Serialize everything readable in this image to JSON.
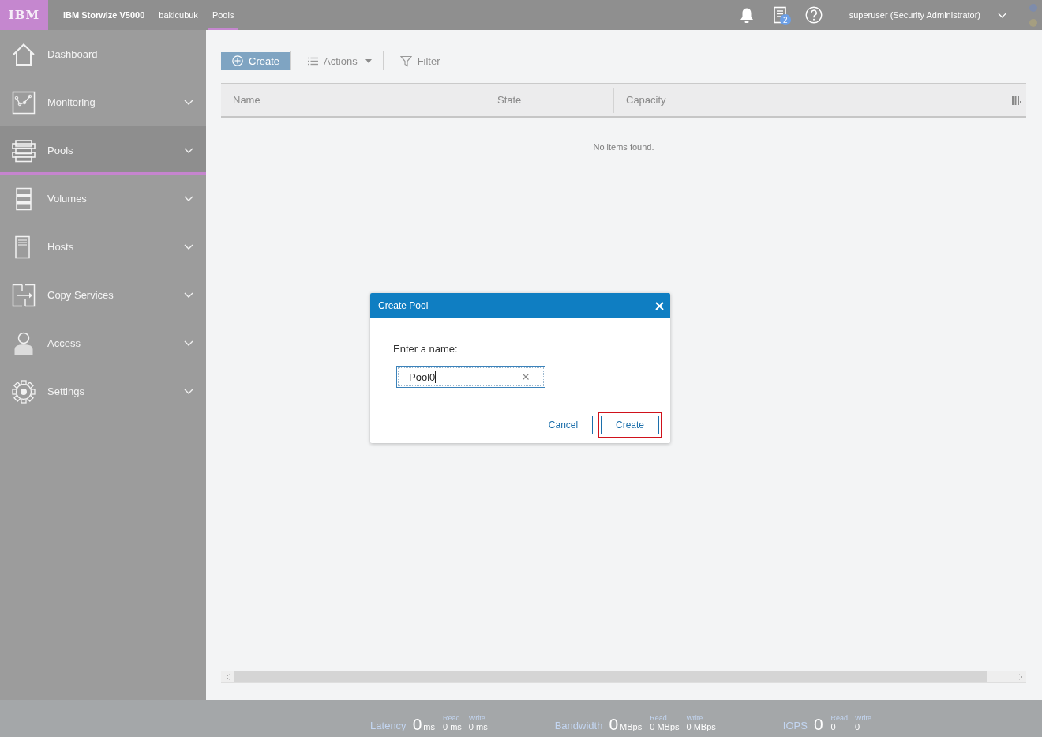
{
  "top_bar": {
    "logo": "IBM",
    "crumbs": [
      {
        "label": "IBM Storwize V5000",
        "selected": false
      },
      {
        "label": "bakicubuk",
        "selected": false
      },
      {
        "label": "Pools",
        "selected": true
      }
    ],
    "tasks_badge": "2",
    "user": "superuser (Security Administrator)"
  },
  "sidebar": {
    "items": [
      {
        "label": "Dashboard",
        "expandable": false,
        "selected": false
      },
      {
        "label": "Monitoring",
        "expandable": true,
        "selected": false
      },
      {
        "label": "Pools",
        "expandable": true,
        "selected": true
      },
      {
        "label": "Volumes",
        "expandable": true,
        "selected": false
      },
      {
        "label": "Hosts",
        "expandable": true,
        "selected": false
      },
      {
        "label": "Copy Services",
        "expandable": true,
        "selected": false
      },
      {
        "label": "Access",
        "expandable": true,
        "selected": false
      },
      {
        "label": "Settings",
        "expandable": true,
        "selected": false
      }
    ]
  },
  "toolbar": {
    "create": "Create",
    "actions": "Actions",
    "filter": "Filter"
  },
  "table": {
    "columns": [
      "Name",
      "State",
      "Capacity"
    ],
    "empty_message": "No items found."
  },
  "dialog": {
    "title": "Create Pool",
    "field_label": "Enter a name:",
    "name_field": {
      "value": "Pool0"
    },
    "buttons": [
      {
        "label": "Cancel",
        "highlighted": false
      },
      {
        "label": "Create",
        "highlighted": true
      }
    ]
  },
  "status_bar": {
    "metrics": [
      {
        "label": "Latency",
        "value": "0",
        "unit": "ms",
        "read_label": "Read",
        "read": "0 ms",
        "write_label": "Write",
        "write": "0 ms"
      },
      {
        "label": "Bandwidth",
        "value": "0",
        "unit": "MBps",
        "read_label": "Read",
        "read": "0 MBps",
        "write_label": "Write",
        "write": "0 MBps"
      },
      {
        "label": "IOPS",
        "value": "0",
        "read_label": "Read",
        "read": "0",
        "write_label": "Write",
        "write": "0"
      }
    ]
  }
}
